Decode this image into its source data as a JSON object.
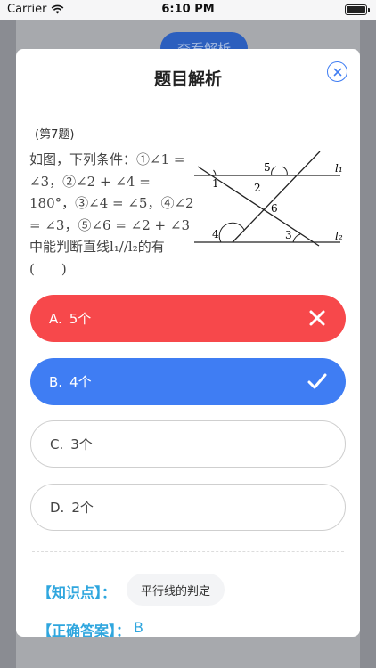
{
  "status_bar": {
    "carrier": "Carrier",
    "time": "6:10 PM"
  },
  "background": {
    "button_label": "查看解析"
  },
  "modal": {
    "title": "题目解析",
    "question": {
      "number": "(第7题)",
      "text": "如图，下列条件：①∠1 = ∠3，②∠2 + ∠4 = 180°，③∠4 = ∠5，④∠2 = ∠3，⑤∠6 = ∠2 + ∠3中能判断直线l₁//l₂的有(　　)"
    },
    "figure": {
      "line_labels": [
        "l₁",
        "l₂"
      ],
      "angle_labels": [
        "1",
        "2",
        "3",
        "4",
        "5",
        "6"
      ]
    },
    "options": [
      {
        "letter": "A.",
        "text": "5个",
        "state": "wrong",
        "mark_icon": "cross-icon"
      },
      {
        "letter": "B.",
        "text": "4个",
        "state": "correct",
        "mark_icon": "check-icon"
      },
      {
        "letter": "C.",
        "text": "3个",
        "state": "plain"
      },
      {
        "letter": "D.",
        "text": "2个",
        "state": "plain"
      }
    ],
    "knowledge_point": {
      "label": "【知识点】：",
      "value": "平行线的判定"
    },
    "answer": {
      "label": "【正确答案】：",
      "value": "B"
    }
  },
  "colors": {
    "accent": "#3f7df3",
    "wrong": "#f7484b",
    "label": "#2fa6de",
    "overlay": "#8a8c92"
  }
}
